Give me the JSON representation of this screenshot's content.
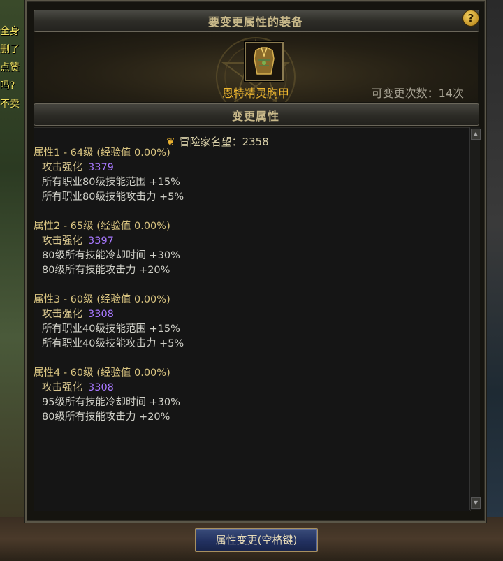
{
  "background_left_text": [
    "全身",
    "删了",
    "点赞",
    "吗?",
    "不卖"
  ],
  "window": {
    "title": "要变更属性的装备",
    "help_icon": "?",
    "item_icon": "chest-armor-icon",
    "item_name": "恩特精灵胸甲",
    "change_count": "可变更次数：14次"
  },
  "section": {
    "title": "变更属性"
  },
  "reputation": {
    "icon": "reputation-laurel-icon",
    "text": "冒险家名望：2358"
  },
  "attributes": [
    {
      "title": "属性1 - 64级 (经验值 0.00%)",
      "lines": [
        {
          "label": "攻击强化",
          "value": "3379"
        },
        {
          "label": "所有职业80级技能范围 +15%"
        },
        {
          "label": "所有职业80级技能攻击力 +5%"
        }
      ]
    },
    {
      "title": "属性2 - 65级 (经验值 0.00%)",
      "lines": [
        {
          "label": "攻击强化",
          "value": "3397"
        },
        {
          "label": "80级所有技能冷却时间 +30%"
        },
        {
          "label": "80级所有技能攻击力 +20%"
        }
      ]
    },
    {
      "title": "属性3 - 60级 (经验值 0.00%)",
      "lines": [
        {
          "label": "攻击强化",
          "value": "3308"
        },
        {
          "label": "所有职业40级技能范围 +15%"
        },
        {
          "label": "所有职业40级技能攻击力 +5%"
        }
      ]
    },
    {
      "title": "属性4 - 60级 (经验值 0.00%)",
      "lines": [
        {
          "label": "攻击强化",
          "value": "3308"
        },
        {
          "label": "95级所有技能冷却时间 +30%"
        },
        {
          "label": "80级所有技能攻击力 +20%"
        }
      ]
    }
  ],
  "bottom_button": "属性变更(空格键)",
  "colors": {
    "gold_title": "#c9b98a",
    "item_name": "#f0b830",
    "value_purple": "#a878ff"
  }
}
